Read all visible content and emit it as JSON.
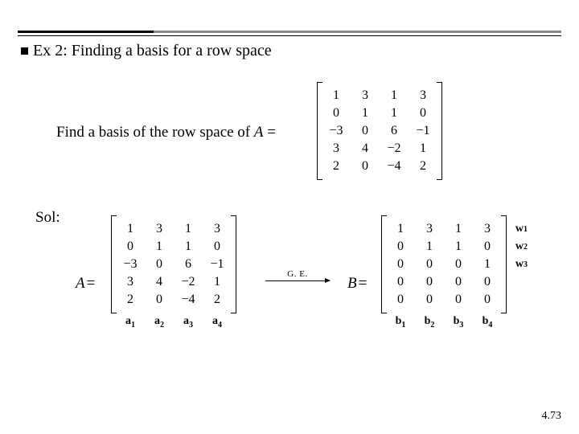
{
  "title": "Ex 2: Finding a basis for a row space",
  "prompt_prefix": "Find a basis of the row space of  ",
  "prompt_var": "A",
  "prompt_eq": " = ",
  "sol_label": "Sol:",
  "A_label": "A",
  "B_label": "B",
  "eq": " = ",
  "arrow_label": "G. E.",
  "matrix_top": [
    [
      "1",
      "3",
      "1",
      "3"
    ],
    [
      "0",
      "1",
      "1",
      "0"
    ],
    [
      "−3",
      "0",
      "6",
      "−1"
    ],
    [
      "3",
      "4",
      "−2",
      "1"
    ],
    [
      "2",
      "0",
      "−4",
      "2"
    ]
  ],
  "matrix_A": [
    [
      "1",
      "3",
      "1",
      "3"
    ],
    [
      "0",
      "1",
      "1",
      "0"
    ],
    [
      "−3",
      "0",
      "6",
      "−1"
    ],
    [
      "3",
      "4",
      "−2",
      "1"
    ],
    [
      "2",
      "0",
      "−4",
      "2"
    ]
  ],
  "matrix_B": [
    [
      "1",
      "3",
      "1",
      "3"
    ],
    [
      "0",
      "1",
      "1",
      "0"
    ],
    [
      "0",
      "0",
      "0",
      "1"
    ],
    [
      "0",
      "0",
      "0",
      "0"
    ],
    [
      "0",
      "0",
      "0",
      "0"
    ]
  ],
  "col_labels_A": [
    "a",
    "a",
    "a",
    "a"
  ],
  "col_subs_A": [
    "1",
    "2",
    "3",
    "4"
  ],
  "col_labels_B": [
    "b",
    "b",
    "b",
    "b"
  ],
  "col_subs_B": [
    "1",
    "2",
    "3",
    "4"
  ],
  "row_labels_B": [
    "w",
    "w",
    "w"
  ],
  "row_subs_B": [
    "1",
    "2",
    "3"
  ],
  "page_num": "4.73"
}
